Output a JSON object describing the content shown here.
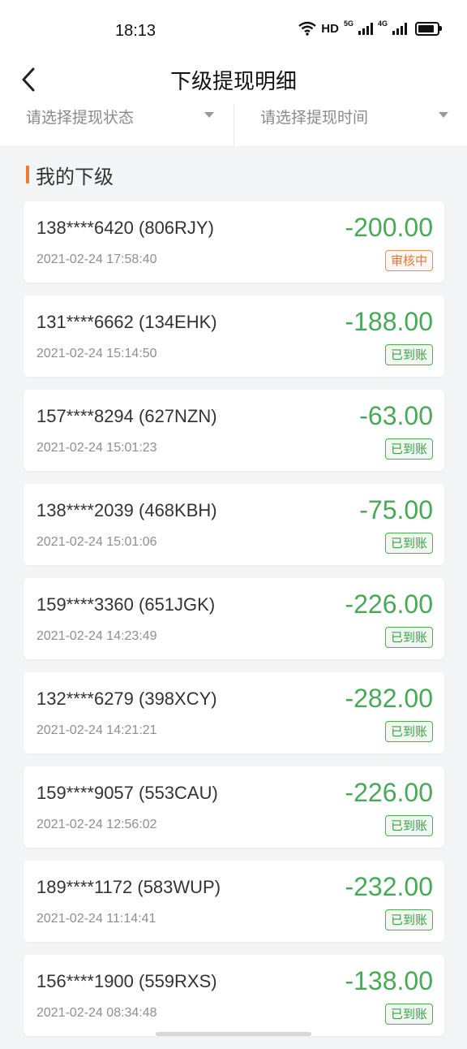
{
  "status_bar": {
    "time": "18:13",
    "hd": "HD",
    "net1": "5G",
    "net2": "4G"
  },
  "nav": {
    "title": "下级提现明细"
  },
  "filters": {
    "status_placeholder": "请选择提现状态",
    "time_placeholder": "请选择提现时间"
  },
  "section": {
    "title": "我的下级"
  },
  "colors": {
    "amount": "#4aa859",
    "accent": "#f07a2c",
    "badge_success": "#4caf50",
    "badge_pending": "#e9905a"
  },
  "records": [
    {
      "user": "138****6420 (806RJY)",
      "time": "2021-02-24 17:58:40",
      "amount": "-200.00",
      "status": "审核中",
      "status_type": "pending"
    },
    {
      "user": "131****6662 (134EHK)",
      "time": "2021-02-24 15:14:50",
      "amount": "-188.00",
      "status": "已到账",
      "status_type": "success"
    },
    {
      "user": "157****8294 (627NZN)",
      "time": "2021-02-24 15:01:23",
      "amount": "-63.00",
      "status": "已到账",
      "status_type": "success"
    },
    {
      "user": "138****2039 (468KBH)",
      "time": "2021-02-24 15:01:06",
      "amount": "-75.00",
      "status": "已到账",
      "status_type": "success"
    },
    {
      "user": "159****3360 (651JGK)",
      "time": "2021-02-24 14:23:49",
      "amount": "-226.00",
      "status": "已到账",
      "status_type": "success"
    },
    {
      "user": "132****6279 (398XCY)",
      "time": "2021-02-24 14:21:21",
      "amount": "-282.00",
      "status": "已到账",
      "status_type": "success"
    },
    {
      "user": "159****9057 (553CAU)",
      "time": "2021-02-24 12:56:02",
      "amount": "-226.00",
      "status": "已到账",
      "status_type": "success"
    },
    {
      "user": "189****1172 (583WUP)",
      "time": "2021-02-24 11:14:41",
      "amount": "-232.00",
      "status": "已到账",
      "status_type": "success"
    },
    {
      "user": "156****1900 (559RXS)",
      "time": "2021-02-24 08:34:48",
      "amount": "-138.00",
      "status": "已到账",
      "status_type": "success"
    }
  ]
}
